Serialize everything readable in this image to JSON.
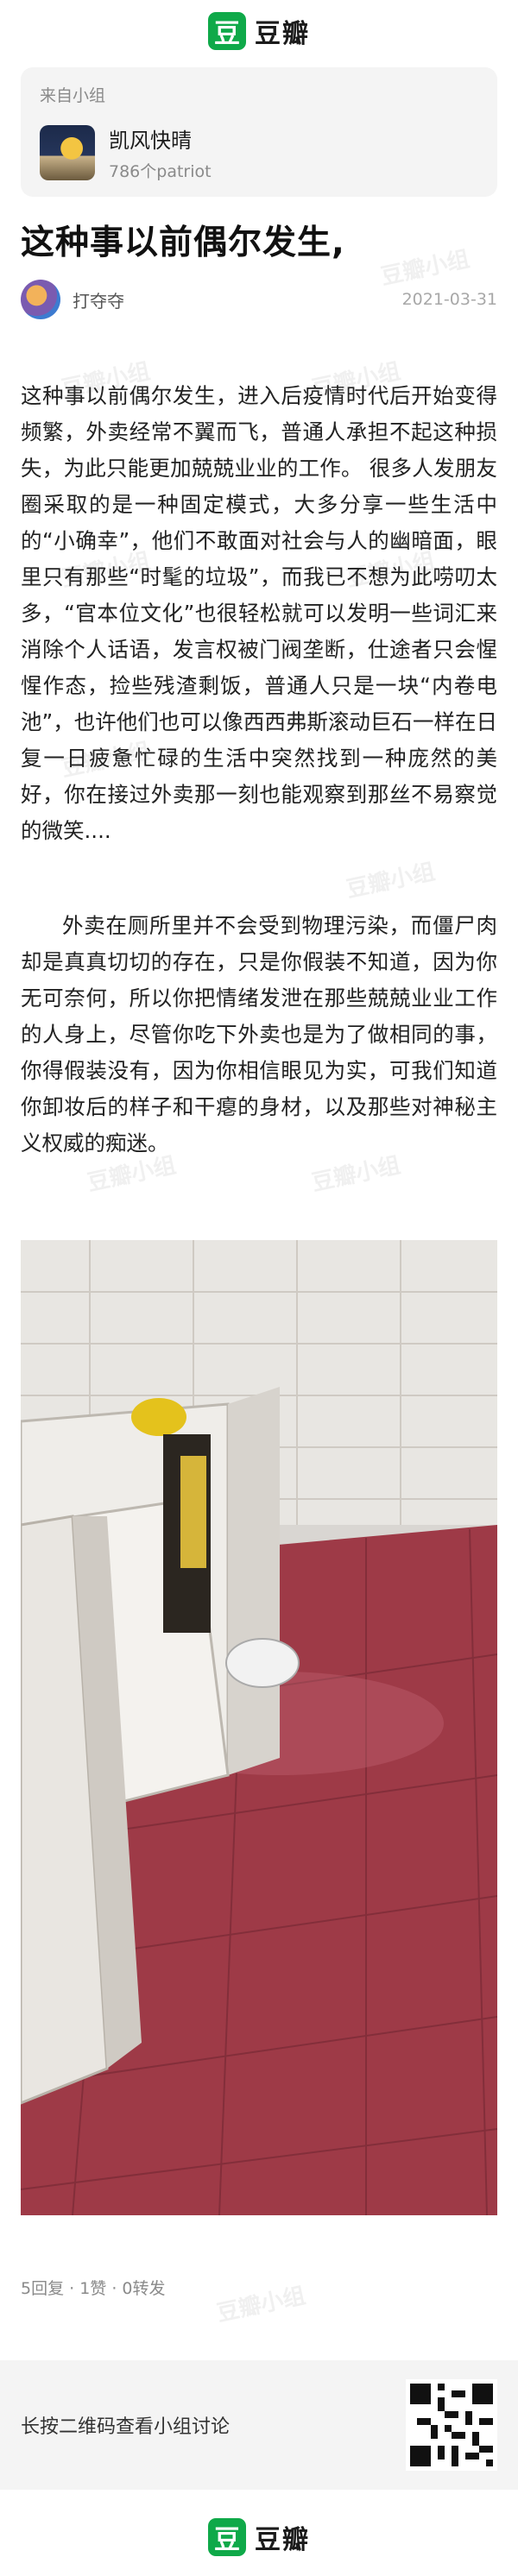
{
  "brand": {
    "name": "豆瓣",
    "logo_char": "豆",
    "accent": "#0fa949"
  },
  "group": {
    "from_label": "来自小组",
    "name": "凯风快晴",
    "member_count": "786个patriot"
  },
  "post": {
    "title": "这种事以前偶尔发生,",
    "author": "打夺夺",
    "date": "2021-03-31",
    "paragraphs": [
      "这种事以前偶尔发生，进入后疫情时代后开始变得频繁，外卖经常不翼而飞，普通人承担不起这种损失，为此只能更加兢兢业业的工作。 很多人发朋友圈采取的是一种固定模式，大多分享一些生活中的“小确幸”，他们不敢面对社会与人的幽暗面，眼里只有那些“时髦的垃圾”，而我已不想为此唠叨太多，“官本位文化”也很轻松就可以发明一些词汇来消除个人话语，发言权被门阀垄断，仕途者只会惺惺作态，捡些残渣剩饭，普通人只是一块“内卷电池”，也许他们也可以像西西弗斯滚动巨石一样在日复一日疲惫忙碌的生活中突然找到一种庞然的美好，你在接过外卖那一刻也能观察到那丝不易察觉的微笑....",
      "外卖在厕所里并不会受到物理污染，而僵尸肉却是真真切切的存在，只是你假装不知道，因为你无可奈何，所以你把情绪发泄在那些兢兢业业工作的人身上，尽管你吃下外卖也是为了做相同的事，你得假装没有，因为你相信眼见为实，可我们知道你卸妆后的样子和干瘪的身材，以及那些对神秘主义权威的痴迷。"
    ]
  },
  "stats": "5回复 · 1赞 · 0转发",
  "qr": {
    "prompt": "长按二维码查看小组讨论"
  },
  "watermark": "豆瓣小组"
}
